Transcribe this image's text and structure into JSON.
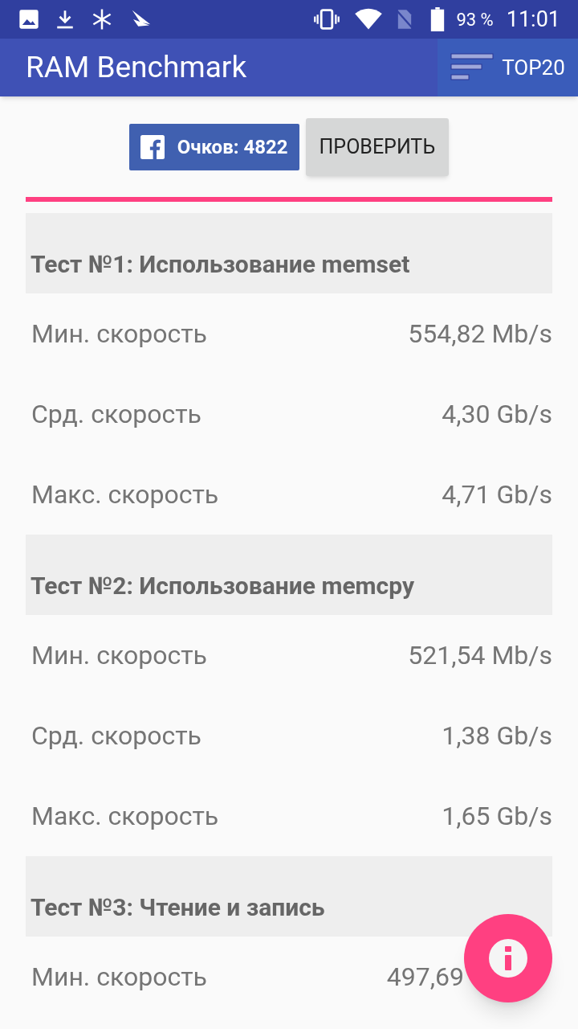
{
  "status_bar": {
    "battery": "93 %",
    "time": "11:01"
  },
  "app_bar": {
    "title": "RAM Benchmark",
    "top_button": "TOP20"
  },
  "score_button": "Очков: 4822",
  "check_button": "ПРОВЕРИТЬ",
  "sections": [
    {
      "title": "Тест №1: Использование memset",
      "rows": [
        {
          "label": "Мин. скорость",
          "value": "554,82 Mb/s"
        },
        {
          "label": "Срд. скорость",
          "value": "4,30 Gb/s"
        },
        {
          "label": "Макс. скорость",
          "value": "4,71 Gb/s"
        }
      ]
    },
    {
      "title": "Тест №2: Использование memcpy",
      "rows": [
        {
          "label": "Мин. скорость",
          "value": "521,54 Mb/s"
        },
        {
          "label": "Срд. скорость",
          "value": "1,38 Gb/s"
        },
        {
          "label": "Макс. скорость",
          "value": "1,65 Gb/s"
        }
      ]
    },
    {
      "title": "Тест №3: Чтение и запись",
      "rows": [
        {
          "label": "Мин. скорость",
          "value": "497,69"
        }
      ]
    }
  ]
}
